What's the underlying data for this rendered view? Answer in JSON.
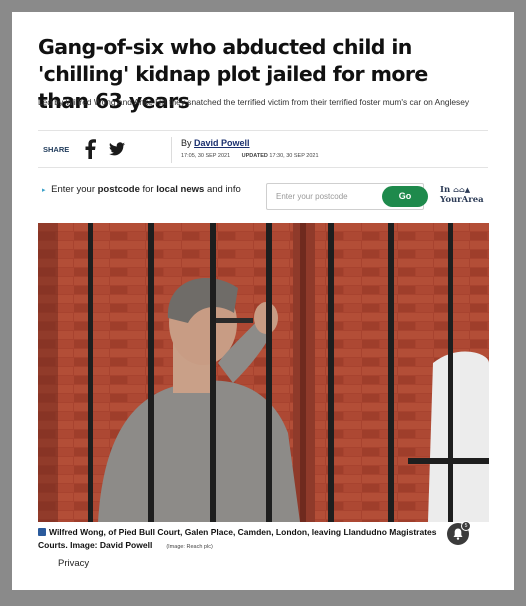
{
  "article": {
    "headline": "Gang-of-six who abducted child in 'chilling' kidnap plot jailed for more than 63 years",
    "standfirst": "Led by Wilfred Wong and Anke Hill they snatched the terrified victim from their terrified foster mum's car on Anglesey"
  },
  "meta": {
    "share_label": "SHARE",
    "by_prefix": "By",
    "author": "David Powell",
    "published": "17:05, 30 SEP 2021",
    "updated_label": "UPDATED",
    "updated": "17:30, 30 SEP 2021"
  },
  "postcode": {
    "line_prefix": "Enter your",
    "bold1": "postcode",
    "mid": "for",
    "bold2": "local news",
    "suffix": "and info",
    "placeholder": "Enter your postcode",
    "button": "Go",
    "brand_line1": "In",
    "brand_line2": "YourArea"
  },
  "photo": {
    "caption": "Wilfred Wong, of Pied Bull Court, Galen Place, Camden, London, leaving Llandudno Magistrates Courts. Image: David Powell",
    "credit": "(Image: Reach plc)"
  },
  "notifications": {
    "count": "5"
  },
  "footer": {
    "privacy": "Privacy"
  }
}
